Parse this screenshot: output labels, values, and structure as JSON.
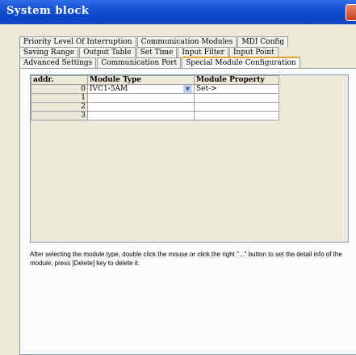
{
  "window": {
    "title": "System block"
  },
  "tabs": {
    "row1": [
      "Priority Level Of Interruption",
      "Communication Modules",
      "MDI Config"
    ],
    "row2": [
      "Saving Range",
      "Output Table",
      "Set Time",
      "Input Filter",
      "Input Point"
    ],
    "row3": [
      "Advanced Settings",
      "Communication Port",
      "Special Module Configuration"
    ],
    "active": "Special Module Configuration"
  },
  "grid": {
    "headers": [
      "addr.",
      "Module Type",
      "Module Property"
    ],
    "rows": [
      {
        "addr": "0",
        "type": "IVC1-5AM",
        "property": "Set->"
      },
      {
        "addr": "1",
        "type": "",
        "property": ""
      },
      {
        "addr": "2",
        "type": "",
        "property": ""
      },
      {
        "addr": "3",
        "type": "",
        "property": ""
      }
    ]
  },
  "note": "After selecting the module type, double click the mouse or click the right \"...\" button to set the detail info of the module, press [Delete] key to delete it."
}
